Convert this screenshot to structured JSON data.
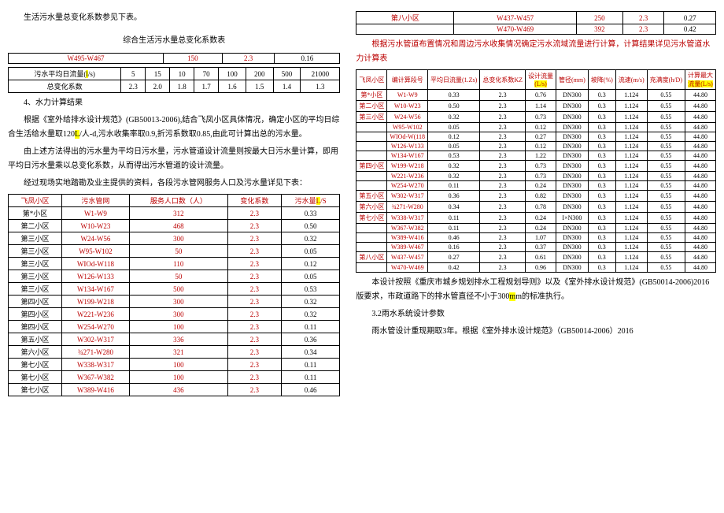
{
  "left": {
    "p1": "生活污水量总变化系数参见下表。",
    "t1title": "综合生活污水量总变化系数表",
    "t1topr1c1": "W495-W467",
    "t1topr1c2": "150",
    "t1topr1c3": "2.3",
    "t1topr1c4": "0.16",
    "t1r1h": "污水平均日流量(",
    "t1r1unit": "l",
    "t1r1h2": "/s)",
    "t1r1v1": "5",
    "t1r1v2": "15",
    "t1r1v3": "10",
    "t1r1v4": "70",
    "t1r1v5": "100",
    "t1r1v6": "200",
    "t1r1v7": "500",
    "t1r1v8": "21000",
    "t1r2h": "总变化系数",
    "t1r2v1": "2.3",
    "t1r2v2": "2.0",
    "t1r2v3": "1.8",
    "t1r2v4": "1.7",
    "t1r2v5": "1.6",
    "t1r2v6": "1.5",
    "t1r2v7": "1.4",
    "t1r2v8": "1.3",
    "s4title": "4、水力计算结果",
    "p2a": "根据《室外给排水设计规范》(GB50013-2006),结合飞凤小区具体情况，确定小区的平均日综合生活给水量取120",
    "p2hl": "L",
    "p2b": "/人-d,污水收集率取0.9,折污系数取0.85,由此可计算出总的污水量。",
    "p3": "由上述方法得出的污水量为平均日污水量，污水管道设计流量则按最大日污水量计算，即用平均日污水量乘以总变化系数，从而得出污水管道的设计流量。",
    "p4": "经过现场实地踏勘及业主提供的资料，各段污水管网服务人口及污水量详见下表：",
    "th1": "飞凤小区",
    "th2": "污水管网",
    "th3": "服务人口数（人）",
    "th4": "变化系数",
    "th5a": "污水量",
    "th5b": "L",
    "th5c": "/S",
    "rows": [
      [
        "第*小区",
        "W1-W9",
        "312",
        "2.3",
        "0.33"
      ],
      [
        "第二小区",
        "W10-W23",
        "468",
        "2.3",
        "0.50"
      ],
      [
        "第三小区",
        "W24-W56",
        "300",
        "2.3",
        "0.32"
      ],
      [
        "第三小区",
        "W95-W102",
        "50",
        "2.3",
        "0.05"
      ],
      [
        "第三小区",
        "WIOd-W118",
        "110",
        "2.3",
        "0.12"
      ],
      [
        "第三小区",
        "W126-W133",
        "50",
        "2.3",
        "0.05"
      ],
      [
        "第三小区",
        "W134-W167",
        "500",
        "2.3",
        "0.53"
      ],
      [
        "第四小区",
        "W199-W218",
        "300",
        "2.3",
        "0.32"
      ],
      [
        "第四小区",
        "W221-W236",
        "300",
        "2.3",
        "0.32"
      ],
      [
        "第四小区",
        "W254-W270",
        "100",
        "2.3",
        "0.11"
      ],
      [
        "第五小区",
        "W302-W317",
        "336",
        "2.3",
        "0.36"
      ],
      [
        "第六小区",
        "¾271-W280",
        "321",
        "2.3",
        "0.34"
      ],
      [
        "第七小区",
        "W338-W317",
        "100",
        "2.3",
        "0.11"
      ],
      [
        "第七小区",
        "W367-W382",
        "100",
        "2.3",
        "0.11"
      ],
      [
        "第七小区",
        "W389-W416",
        "436",
        "2.3",
        "0.46"
      ]
    ]
  },
  "right": {
    "topRows": [
      [
        "第八小区",
        "W437-W457",
        "250",
        "2.3",
        "0.27"
      ],
      [
        "",
        "W470-W469",
        "392",
        "2.3",
        "0.42"
      ]
    ],
    "p1": "根据污水管道布置情况和周边污水收集情况确定污水流域流量进行计算，计算结果详见污水管道水力计算表",
    "th1": "飞凤小区",
    "th2": "编计算段号",
    "th3": "平均日流量(1.Zs)",
    "th4": "总变化系数KZ",
    "th5": "设计流量",
    "th5unit": "(L/s)",
    "th6": "管径(mm)",
    "th7": "坡降(%)",
    "th8": "流速(m/s)",
    "th9": "充满度(h/D)",
    "th10": "计算最大",
    "th10b": "流量(L/s)",
    "rows": [
      [
        "第*小区",
        "W1-W9",
        "0.33",
        "2.3",
        "0.76",
        "DN300",
        "0.3",
        "1.124",
        "0.55",
        "44.80"
      ],
      [
        "第二小区",
        "W10-W23",
        "0.50",
        "2.3",
        "1.14",
        "DN300",
        "0.3",
        "1.124",
        "0.55",
        "44.80"
      ],
      [
        "第三小区",
        "W24-W56",
        "0.32",
        "2.3",
        "0.73",
        "DN300",
        "0.3",
        "1.124",
        "0.55",
        "44.80"
      ],
      [
        "",
        "W95-W102",
        "0.05",
        "2.3",
        "0.12",
        "DN300",
        "0.3",
        "1.124",
        "0.55",
        "44.80"
      ],
      [
        "",
        "WIOd-W(118",
        "0.12",
        "2.3",
        "0.27",
        "DN300",
        "0.3",
        "1.124",
        "0.55",
        "44.80"
      ],
      [
        "",
        "W126-W133",
        "0.05",
        "2.3",
        "0.12",
        "DN300",
        "0.3",
        "1.124",
        "0.55",
        "44.80"
      ],
      [
        "",
        "W134-W167",
        "0.53",
        "2.3",
        "1.22",
        "DN300",
        "0.3",
        "1.124",
        "0.55",
        "44.80"
      ],
      [
        "第四小区",
        "W199-W218",
        "0.32",
        "2.3",
        "0.73",
        "DN300",
        "0.3",
        "1.124",
        "0.55",
        "44.80"
      ],
      [
        "",
        "W221-W236",
        "0.32",
        "2.3",
        "0.73",
        "DN300",
        "0.3",
        "1.124",
        "0.55",
        "44.80"
      ],
      [
        "",
        "W254-W270",
        "0.11",
        "2.3",
        "0.24",
        "DN300",
        "0.3",
        "1.124",
        "0.55",
        "44.80"
      ],
      [
        "第五小区",
        "W302-W317",
        "0.36",
        "2.3",
        "0.82",
        "DN300",
        "0.3",
        "1.124",
        "0.55",
        "44.80"
      ],
      [
        "第六小区",
        "¾271-W280",
        "0.34",
        "2.3",
        "0.78",
        "DN300",
        "0.3",
        "1.124",
        "0.55",
        "44.80"
      ],
      [
        "第七小区",
        "W338-W317",
        "0.11",
        "2.3",
        "0.24",
        "I×N300",
        "0.3",
        "1.124",
        "0.55",
        "44.80"
      ],
      [
        "",
        "W367-W382",
        "0.11",
        "2.3",
        "0.24",
        "DN300",
        "0.3",
        "1.124",
        "0.55",
        "44.80"
      ],
      [
        "",
        "W389-W416",
        "0.46",
        "2.3",
        "1.07",
        "DN300",
        "0.3",
        "1.124",
        "0.55",
        "44.80"
      ],
      [
        "",
        "W389-W467",
        "0.16",
        "2.3",
        "0.37",
        "DN300",
        "0.3",
        "1.124",
        "0.55",
        "44.80"
      ],
      [
        "第八小区",
        "W437-W457",
        "0.27",
        "2.3",
        "0.61",
        "DN300",
        "0.3",
        "1.124",
        "0.55",
        "44.80"
      ],
      [
        "",
        "W470-W469",
        "0.42",
        "2.3",
        "0.96",
        "DN300",
        "0.3",
        "1.124",
        "0.55",
        "44.80"
      ]
    ],
    "p2a": "本设计按照《重庆市城乡规划排水工程规划导则》以及《室外排水设计规范》(GB50014-2006)2016版要求，市政道路下的排水管直径不小于300",
    "p2hl": "m",
    "p2b": "m的标准执行。",
    "s32": "3.2雨水系统设计参数",
    "p3": "雨水管设计重现期取3年。根据《室外排水设计规范》（GB50014-2006）2016"
  }
}
